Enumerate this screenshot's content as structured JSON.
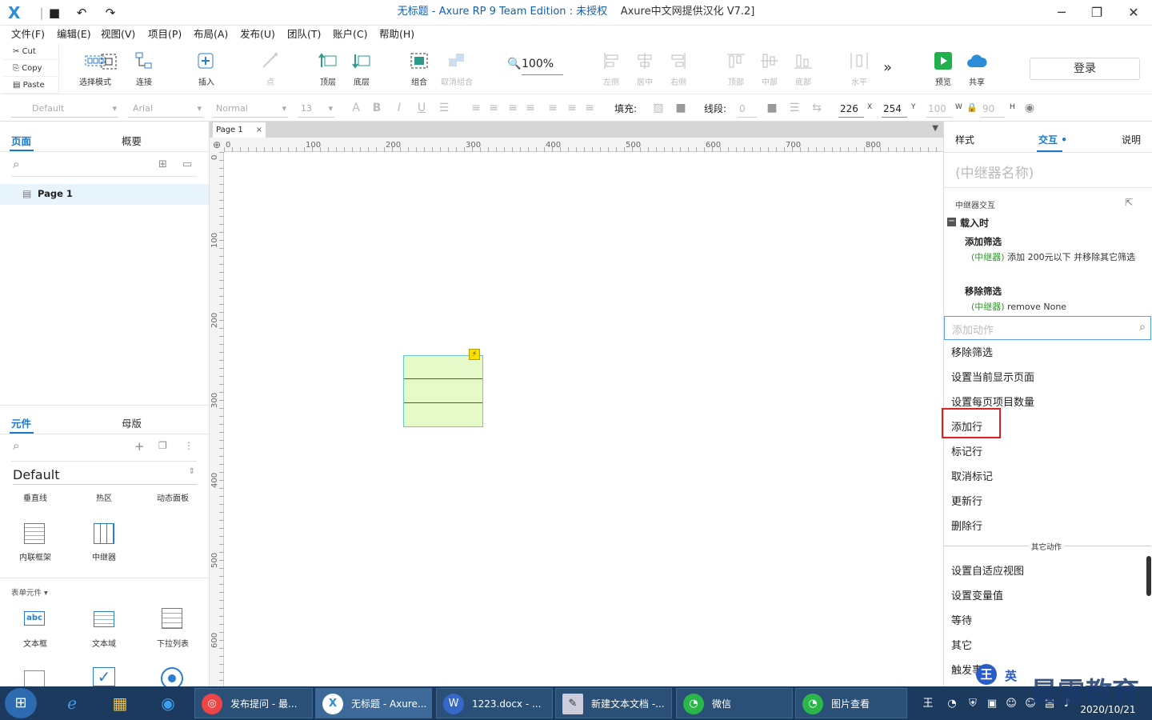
{
  "window": {
    "title": "无标题 - Axure RP 9 Team Edition : 未授权",
    "title_extra": "Axure中文网提供汉化 V7.2]",
    "logo": "X"
  },
  "menu": [
    "文件(F)",
    "编辑(E)",
    "视图(V)",
    "项目(P)",
    "布局(A)",
    "发布(U)",
    "团队(T)",
    "账户(C)",
    "帮助(H)"
  ],
  "clipboard": {
    "cut": "Cut",
    "copy": "Copy",
    "paste": "Paste"
  },
  "tools": {
    "select_mode": "选择模式",
    "connect": "连接",
    "insert": "插入",
    "point": "点",
    "top": "顶层",
    "bottom": "底层",
    "group": "组合",
    "ungroup": "取消组合",
    "zoom": "100%",
    "left": "左侧",
    "center": "居中",
    "right": "右侧",
    "align_top": "顶部",
    "middle": "中部",
    "align_bottom": "底部",
    "horizontal": "水平",
    "more": "»",
    "preview": "预览",
    "share": "共享",
    "login": "登录"
  },
  "format": {
    "style": "Default",
    "font": "Arial",
    "weight": "Normal",
    "size": "13",
    "fill": "填充:",
    "line": "线段:",
    "line_value": "0",
    "x": "226",
    "x_label": "X",
    "y": "254",
    "y_label": "Y",
    "w": "100",
    "w_label": "W",
    "h": "90",
    "h_label": "H"
  },
  "left_panel": {
    "tab_pages": "页面",
    "tab_outline": "概要",
    "page1": "Page 1",
    "tab_widgets": "元件",
    "tab_masters": "母版",
    "library": "Default",
    "widgets_row1": [
      "垂直线",
      "热区",
      "动态面板"
    ],
    "widgets_row2": [
      "内联框架",
      "中继器"
    ],
    "form_section": "表单元件 ▾",
    "form_widgets": [
      "文本框",
      "文本域",
      "下拉列表"
    ]
  },
  "canvas": {
    "doc_tab": "Page 1",
    "close": "×",
    "ruler_h": [
      "0",
      "100",
      "200",
      "300",
      "400",
      "500",
      "600",
      "700",
      "800"
    ],
    "ruler_v": [
      "0",
      "100",
      "200",
      "300",
      "400",
      "500",
      "600"
    ]
  },
  "right_panel": {
    "tab_style": "样式",
    "tab_interaction": "交互",
    "tab_notes": "说明",
    "repeater_name": "(中继器名称)",
    "section": "中继器交互",
    "event": "载入时",
    "action1": "添加筛选",
    "action1_tag": "(中继器)",
    "action1_desc": "添加 200元以下 并移除其它筛选",
    "action2": "移除筛选",
    "action2_tag": "(中继器)",
    "action2_desc": "remove None",
    "search_placeholder": "添加动作",
    "list": [
      "移除筛选",
      "设置当前显示页面",
      "设置每页项目数量",
      "添加行",
      "标记行",
      "取消标记",
      "更新行",
      "删除行"
    ],
    "other_section": "其它动作",
    "other_list": [
      "设置自适应视图",
      "设置变量值",
      "等待",
      "其它",
      "触发事件"
    ]
  },
  "taskbar": {
    "tasks": [
      "发布提问 - 最...",
      "无标题 - Axure...",
      "1223.docx - ...",
      "新建文本文档 -...",
      "微信",
      "图片查看"
    ],
    "date": "2020/10/21",
    "watermark": "最需教育"
  }
}
